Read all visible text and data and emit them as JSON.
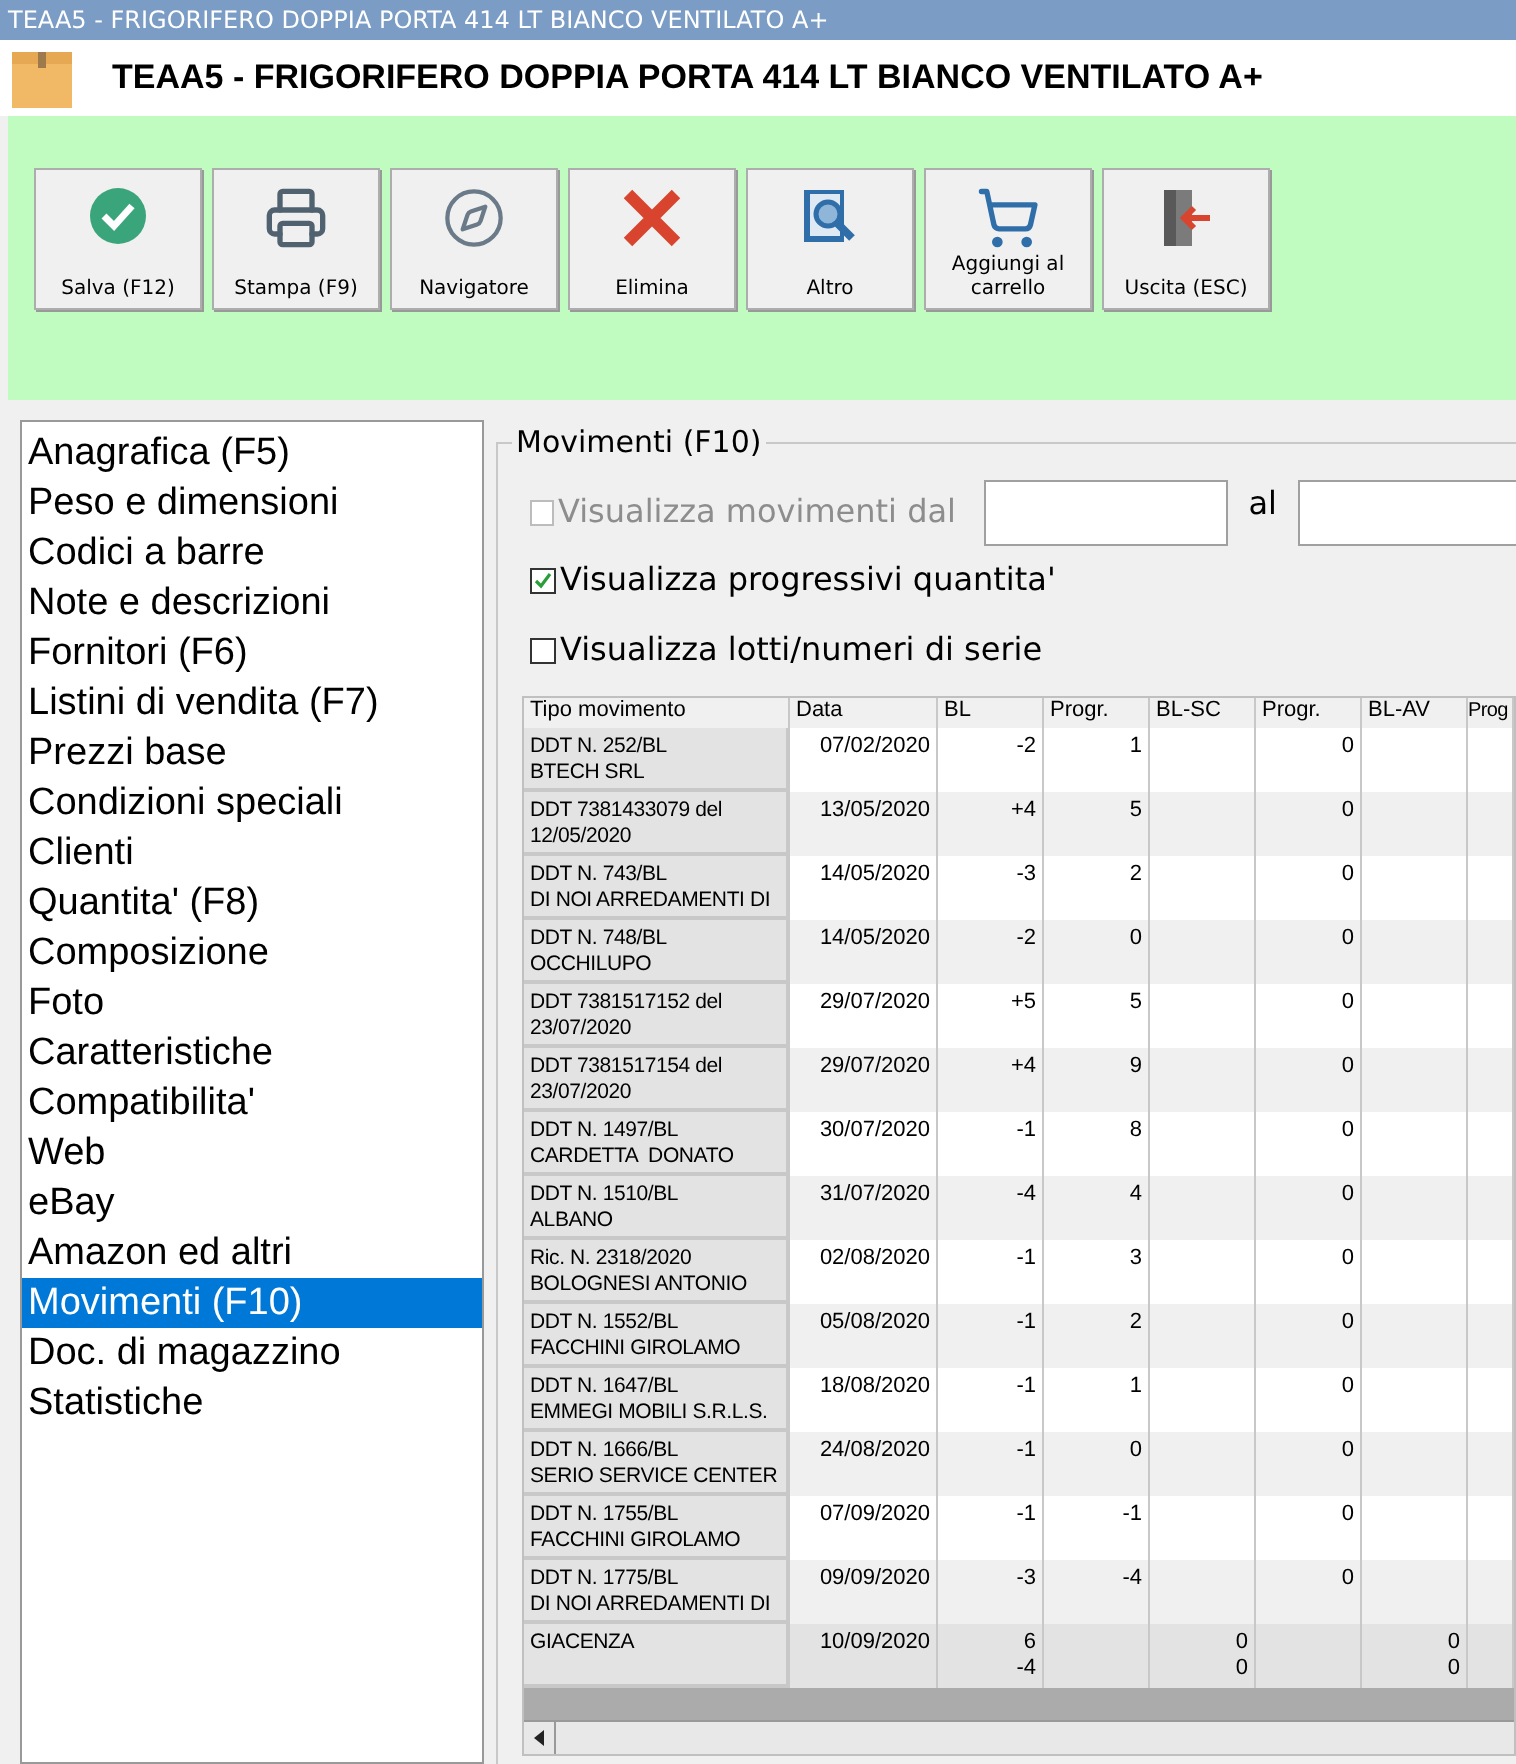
{
  "window": {
    "title": "TEAA5 - FRIGORIFERO DOPPIA PORTA 414 LT BIANCO VENTILATO A+"
  },
  "header": {
    "title": "TEAA5 - FRIGORIFERO DOPPIA PORTA 414 LT BIANCO VENTILATO A+"
  },
  "toolbar": [
    {
      "label": "Salva (F12)",
      "kind": "save"
    },
    {
      "label": "Stampa (F9)",
      "kind": "print"
    },
    {
      "label": "Navigatore",
      "kind": "navigator"
    },
    {
      "label": "Elimina",
      "kind": "delete"
    },
    {
      "label": "Altro",
      "kind": "more"
    },
    {
      "label": "Aggiungi al\ncarrello",
      "kind": "cart"
    },
    {
      "label": "Uscita (ESC)",
      "kind": "exit"
    }
  ],
  "sidebar": {
    "items": [
      {
        "label": "Anagrafica (F5)",
        "selected": false
      },
      {
        "label": "Peso e dimensioni",
        "selected": false
      },
      {
        "label": "Codici a barre",
        "selected": false
      },
      {
        "label": "Note e descrizioni",
        "selected": false
      },
      {
        "label": "Fornitori (F6)",
        "selected": false
      },
      {
        "label": "Listini di vendita (F7)",
        "selected": false
      },
      {
        "label": "Prezzi base",
        "selected": false
      },
      {
        "label": "Condizioni speciali",
        "selected": false
      },
      {
        "label": "Clienti",
        "selected": false
      },
      {
        "label": "Quantita' (F8)",
        "selected": false
      },
      {
        "label": "Composizione",
        "selected": false
      },
      {
        "label": "Foto",
        "selected": false
      },
      {
        "label": "Caratteristiche",
        "selected": false
      },
      {
        "label": "Compatibilita'",
        "selected": false
      },
      {
        "label": "Web",
        "selected": false
      },
      {
        "label": "eBay",
        "selected": false
      },
      {
        "label": "Amazon ed altri",
        "selected": false
      },
      {
        "label": "Movimenti (F10)",
        "selected": true
      },
      {
        "label": "Doc. di magazzino",
        "selected": false
      },
      {
        "label": "Statistiche",
        "selected": false
      }
    ]
  },
  "panel": {
    "title": "Movimenti (F10)",
    "date_filter": {
      "label": "Visualizza movimenti dal",
      "checked": false,
      "disabled": true,
      "to_label": "al"
    },
    "options": [
      {
        "label": "Visualizza progressivi quantita'",
        "checked": true
      },
      {
        "label": "Visualizza lotti/numeri di serie",
        "checked": false
      }
    ],
    "table": {
      "columns": [
        "Tipo movimento",
        "Data",
        "BL",
        "Progr.",
        "BL-SC",
        "Progr.",
        "BL-AV",
        "Prog"
      ],
      "rows": [
        {
          "kind": "movement",
          "cells": [
            "DDT N. 252/BL\nBTECH SRL",
            "07/02/2020",
            "-2",
            "1",
            "",
            "0",
            "",
            ""
          ]
        },
        {
          "kind": "movement",
          "cells": [
            "DDT 7381433079 del\n12/05/2020",
            "13/05/2020",
            "+4",
            "5",
            "",
            "0",
            "",
            ""
          ]
        },
        {
          "kind": "movement",
          "cells": [
            "DDT N. 743/BL\nDI NOI ARREDAMENTI DI",
            "14/05/2020",
            "-3",
            "2",
            "",
            "0",
            "",
            ""
          ]
        },
        {
          "kind": "movement",
          "cells": [
            "DDT N. 748/BL\nOCCHILUPO",
            "14/05/2020",
            "-2",
            "0",
            "",
            "0",
            "",
            ""
          ]
        },
        {
          "kind": "movement",
          "cells": [
            "DDT 7381517152 del\n23/07/2020",
            "29/07/2020",
            "+5",
            "5",
            "",
            "0",
            "",
            ""
          ]
        },
        {
          "kind": "movement",
          "cells": [
            "DDT 7381517154 del\n23/07/2020",
            "29/07/2020",
            "+4",
            "9",
            "",
            "0",
            "",
            ""
          ]
        },
        {
          "kind": "movement",
          "cells": [
            "DDT N. 1497/BL\nCARDETTA  DONATO",
            "30/07/2020",
            "-1",
            "8",
            "",
            "0",
            "",
            ""
          ]
        },
        {
          "kind": "movement",
          "cells": [
            "DDT N. 1510/BL\nALBANO",
            "31/07/2020",
            "-4",
            "4",
            "",
            "0",
            "",
            ""
          ]
        },
        {
          "kind": "movement",
          "cells": [
            "Ric. N. 2318/2020\nBOLOGNESI ANTONIO",
            "02/08/2020",
            "-1",
            "3",
            "",
            "0",
            "",
            ""
          ]
        },
        {
          "kind": "movement",
          "cells": [
            "DDT N. 1552/BL\nFACCHINI GIROLAMO",
            "05/08/2020",
            "-1",
            "2",
            "",
            "0",
            "",
            ""
          ]
        },
        {
          "kind": "movement",
          "cells": [
            "DDT N. 1647/BL\nEMMEGI MOBILI S.R.L.S.",
            "18/08/2020",
            "-1",
            "1",
            "",
            "0",
            "",
            ""
          ]
        },
        {
          "kind": "movement",
          "cells": [
            "DDT N. 1666/BL\nSERIO SERVICE CENTER",
            "24/08/2020",
            "-1",
            "0",
            "",
            "0",
            "",
            ""
          ]
        },
        {
          "kind": "movement",
          "cells": [
            "DDT N. 1755/BL\nFACCHINI GIROLAMO",
            "07/09/2020",
            "-1",
            "-1",
            "",
            "0",
            "",
            ""
          ]
        },
        {
          "kind": "movement",
          "cells": [
            "DDT N. 1775/BL\nDI NOI ARREDAMENTI DI",
            "09/09/2020",
            "-3",
            "-4",
            "",
            "0",
            "",
            ""
          ]
        },
        {
          "kind": "total",
          "cells": [
            "GIACENZA",
            "10/09/2020",
            "6\n-4",
            "",
            "0\n0",
            "",
            "0\n0",
            ""
          ]
        }
      ]
    }
  }
}
